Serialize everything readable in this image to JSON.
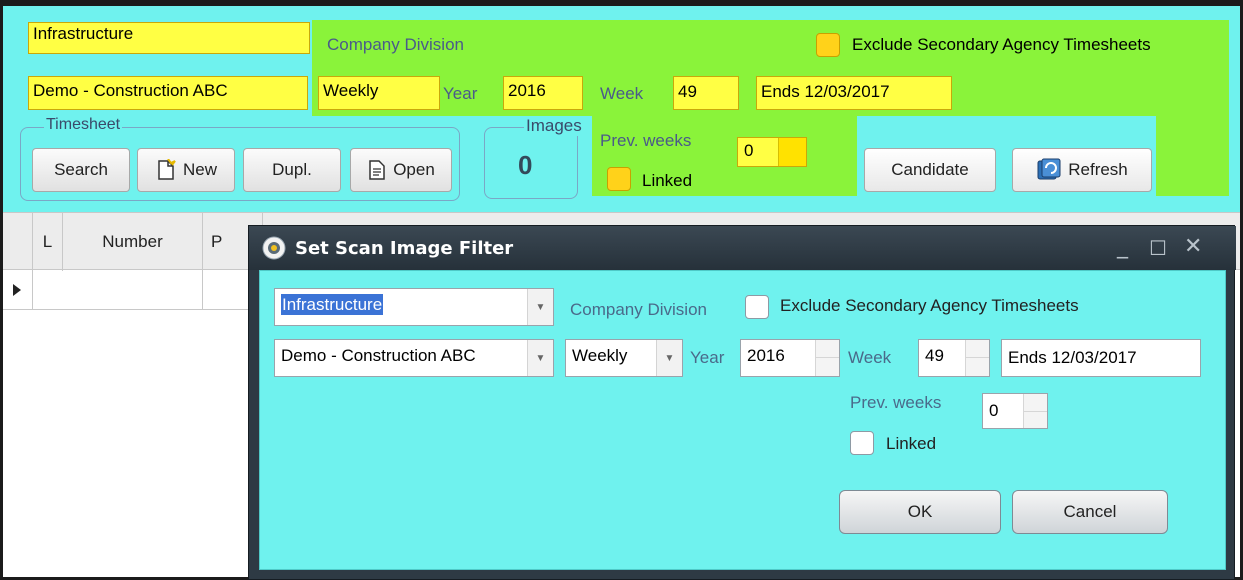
{
  "filter_bar": {
    "division": "Infrastructure",
    "division_label": "Company Division",
    "exclude_label": "Exclude Secondary Agency Timesheets",
    "company": "Demo - Construction ABC",
    "period": "Weekly",
    "year_label": "Year",
    "year": "2016",
    "week_label": "Week",
    "week": "49",
    "ends": "Ends 12/03/2017",
    "prev_weeks_label": "Prev. weeks",
    "prev_weeks": "0",
    "linked_label": "Linked"
  },
  "timesheet_group": {
    "title": "Timesheet",
    "search": "Search",
    "new": "New",
    "dupl": "Dupl.",
    "open": "Open"
  },
  "images_group": {
    "title": "Images",
    "count": "0"
  },
  "actions": {
    "candidate": "Candidate",
    "refresh": "Refresh"
  },
  "grid": {
    "columns": [
      "L",
      "Number",
      "P"
    ]
  },
  "dialog": {
    "title": "Set Scan Image Filter",
    "division": "Infrastructure",
    "division_label": "Company Division",
    "exclude_label": "Exclude Secondary Agency Timesheets",
    "company": "Demo - Construction ABC",
    "period": "Weekly",
    "year_label": "Year",
    "year": "2016",
    "week_label": "Week",
    "week": "49",
    "ends": "Ends 12/03/2017",
    "prev_weeks_label": "Prev. weeks",
    "prev_weeks": "0",
    "linked_label": "Linked",
    "ok": "OK",
    "cancel": "Cancel"
  },
  "colors": {
    "cyan_bg": "#6ff2ee",
    "green_bg": "#8af33a",
    "yellow_field": "#ffff44",
    "dialog_chrome": "#2e3a44"
  }
}
